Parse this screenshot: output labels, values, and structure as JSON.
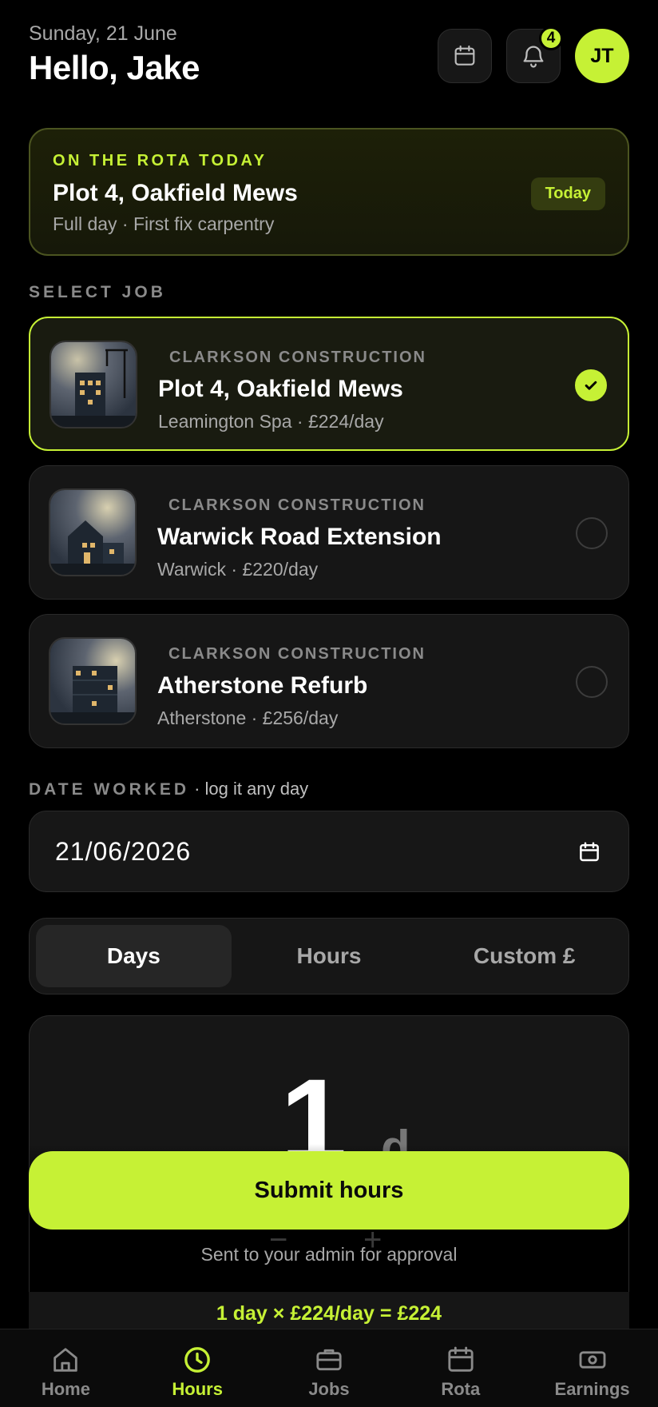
{
  "header": {
    "date": "Sunday, 21 June",
    "greeting": "Hello, Jake",
    "notifications_count": "4",
    "avatar_initials": "JT"
  },
  "rota": {
    "eyebrow": "ON THE ROTA TODAY",
    "title": "Plot 4, Oakfield Mews",
    "subtitle": "Full day · First fix carpentry",
    "pill": "Today"
  },
  "select_job": {
    "label": "SELECT JOB",
    "jobs": [
      {
        "company": "CLARKSON CONSTRUCTION",
        "title": "Plot 4, Oakfield Mews",
        "meta": "Leamington Spa · £224/day",
        "selected": true
      },
      {
        "company": "CLARKSON CONSTRUCTION",
        "title": "Warwick Road Extension",
        "meta": "Warwick · £220/day",
        "selected": false
      },
      {
        "company": "CLARKSON CONSTRUCTION",
        "title": "Atherstone Refurb",
        "meta": "Atherstone · £256/day",
        "selected": false
      }
    ]
  },
  "date_worked": {
    "label": "DATE WORKED",
    "note": "· log it any day",
    "value": "21/06/2026"
  },
  "mode": {
    "options": [
      "Days",
      "Hours",
      "Custom £"
    ],
    "active": "Days"
  },
  "amount": {
    "value": "1",
    "unit": "d",
    "minus": "−",
    "plus": "+"
  },
  "submit": {
    "label": "Submit hours",
    "note": "Sent to your admin for approval",
    "calculation": "1 day × £224/day = £224"
  },
  "tabs": [
    {
      "label": "Home",
      "icon": "home-icon"
    },
    {
      "label": "Hours",
      "icon": "clock-icon",
      "active": true
    },
    {
      "label": "Jobs",
      "icon": "briefcase-icon"
    },
    {
      "label": "Rota",
      "icon": "calendar-icon"
    },
    {
      "label": "Earnings",
      "icon": "cash-icon"
    }
  ],
  "colors": {
    "accent": "#c6f135",
    "background": "#000000",
    "card": "#161616"
  }
}
